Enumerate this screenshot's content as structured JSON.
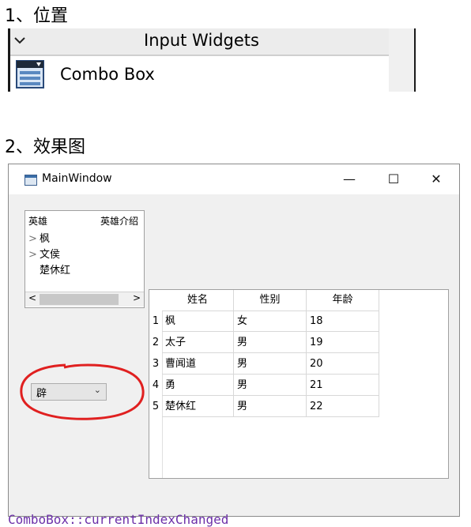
{
  "section1": {
    "heading": "1、位置"
  },
  "widget_box": {
    "group_title": "Input Widgets",
    "item_label": "Combo Box"
  },
  "section2": {
    "heading": "2、效果图"
  },
  "window": {
    "title": "MainWindow",
    "controls": {
      "minimize": "—",
      "maximize": "☐",
      "close": "✕"
    },
    "tree": {
      "headers": [
        "英雄",
        "英雄介绍"
      ],
      "items": [
        {
          "arrow": ">",
          "label": "枫"
        },
        {
          "arrow": ">",
          "label": "文侯"
        },
        {
          "arrow": "",
          "label": "楚休红"
        }
      ],
      "scroll_left": "<",
      "scroll_right": ">"
    },
    "combo": {
      "value": "辟",
      "arrow": "⌄"
    },
    "table": {
      "headers": [
        "姓名",
        "性别",
        "年龄"
      ],
      "rows": [
        {
          "n": "1",
          "name": "枫",
          "sex": "女",
          "age": "18"
        },
        {
          "n": "2",
          "name": "太子",
          "sex": "男",
          "age": "19"
        },
        {
          "n": "3",
          "name": "曹闻道",
          "sex": "男",
          "age": "20"
        },
        {
          "n": "4",
          "name": "勇",
          "sex": "男",
          "age": "21"
        },
        {
          "n": "5",
          "name": "楚休红",
          "sex": "男",
          "age": "22"
        }
      ]
    }
  },
  "background_code": "ComboBox::currentIndexChanged",
  "colors": {
    "highlight_circle": "#e02020",
    "window_bg": "#f0f0f0"
  }
}
